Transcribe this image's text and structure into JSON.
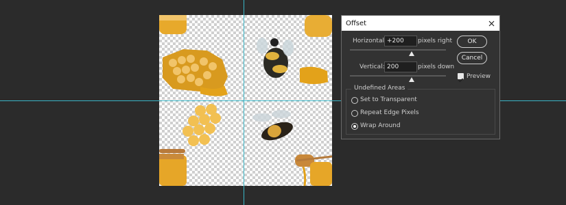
{
  "dialog": {
    "title": "Offset",
    "horizontal": {
      "label": "Horizontal:",
      "value": "+200",
      "unit": "pixels right"
    },
    "vertical": {
      "label": "Vertical:",
      "value": "200",
      "unit": "pixels down"
    },
    "ok": "OK",
    "cancel": "Cancel",
    "preview": {
      "label": "Preview",
      "checked": true
    },
    "undefined_areas": {
      "title": "Undefined Areas",
      "options": [
        "Set to Transparent",
        "Repeat Edge Pixels",
        "Wrap Around"
      ],
      "selected": "Wrap Around"
    }
  },
  "colors": {
    "guide": "#3ab7c8",
    "honey": "#e3a21a",
    "dialog_bg": "#323232"
  }
}
